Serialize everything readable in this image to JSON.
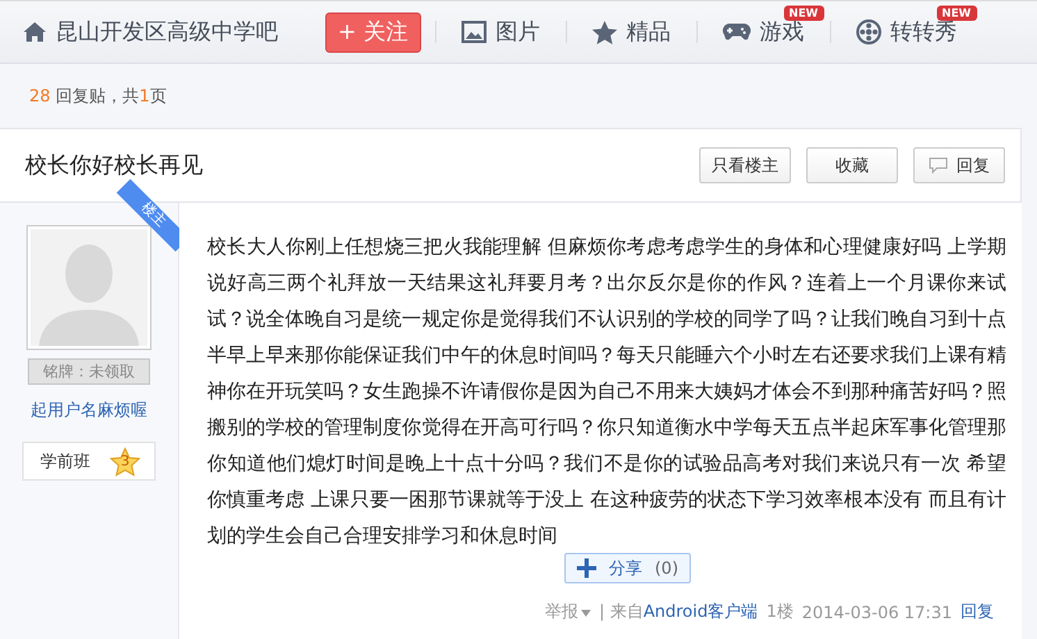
{
  "nav": {
    "forum": "昆山开发区高级中学吧",
    "follow": "+ 关注",
    "items": [
      {
        "kind": "picture",
        "label": "图片"
      },
      {
        "kind": "star",
        "label": "精品"
      },
      {
        "kind": "game",
        "label": "游戏",
        "badge": "NEW"
      },
      {
        "kind": "wheel",
        "label": "转转秀",
        "badge": "NEW"
      }
    ]
  },
  "pager": {
    "count": "28",
    "text": "回复贴，共",
    "pages": "1",
    "suffix": "页"
  },
  "thread": {
    "title": "校长你好校长再见",
    "buttons": [
      {
        "kind": "plain",
        "label": "只看楼主"
      },
      {
        "kind": "plain",
        "label": "收藏"
      },
      {
        "kind": "reply",
        "label": "回复"
      }
    ]
  },
  "author": {
    "corner": "楼主",
    "nameplate": "铭牌：未领取",
    "name": "起用户名麻烦喔",
    "rank": "学前班",
    "level_badge": "3"
  },
  "post": {
    "body": "校长大人你刚上任想烧三把火我能理解 但麻烦你考虑考虑学生的身体和心理健康好吗 上学期说好高三两个礼拜放一天结果这礼拜要月考？出尔反尔是你的作风？连着上一个月课你来试试？说全体晚自习是统一规定你是觉得我们不认识别的学校的同学了吗？让我们晚自习到十点半早上早来那你能保证我们中午的休息时间吗？每天只能睡六个小时左右还要求我们上课有精神你在开玩笑吗？女生跑操不许请假你是因为自己不用来大姨妈才体会不到那种痛苦好吗？照搬别的学校的管理制度你觉得在开高可行吗？你只知道衡水中学每天五点半起床军事化管理那你知道他们熄灯时间是晚上十点十分吗？我们不是你的试验品高考对我们来说只有一次 希望你慎重考虑 上课只要一困那节课就等于没上 在这种疲劳的状态下学习效率根本没有 而且有计划的学生会自己合理安排学习和休息时间",
    "share": "分享",
    "share_count": "(0)",
    "report": "举报",
    "source_prefix": "| 来自",
    "source": "Android客户端",
    "floor": "1楼",
    "time": "2014-03-06 17:31",
    "reply": "回复"
  }
}
